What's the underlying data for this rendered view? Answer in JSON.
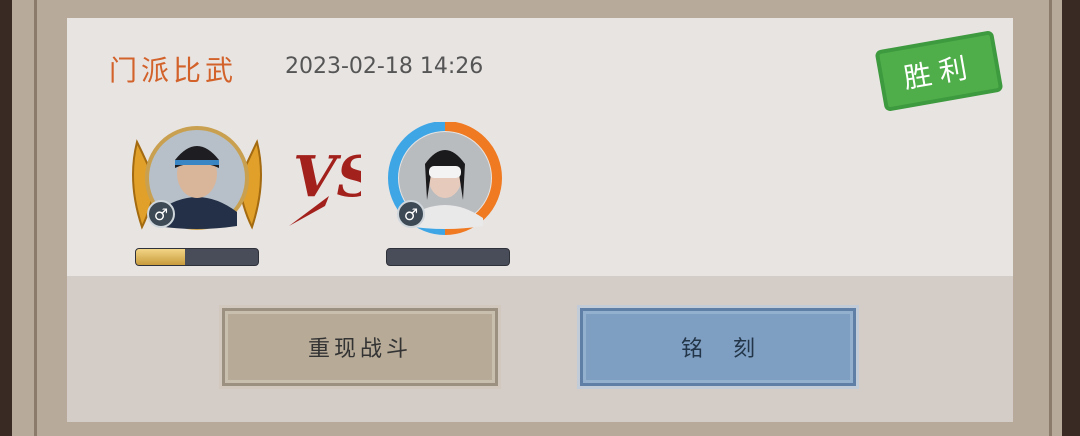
{
  "record": {
    "title": "门派比武",
    "timestamp": "2023-02-18 14:26",
    "result": "胜利",
    "vs": "VS"
  },
  "players": [
    {
      "gender_icon": "♂",
      "progress": 0.4
    },
    {
      "gender_icon": "♂",
      "progress": 0
    }
  ],
  "buttons": {
    "replay_label": "重现战斗",
    "engrave_label": "铭刻"
  },
  "colors": {
    "title": "#d2622a",
    "stamp": "#4fae4a",
    "vs": "#a3211c",
    "replay_button": "#b7ab98",
    "engrave_button": "#7f9fc2"
  }
}
